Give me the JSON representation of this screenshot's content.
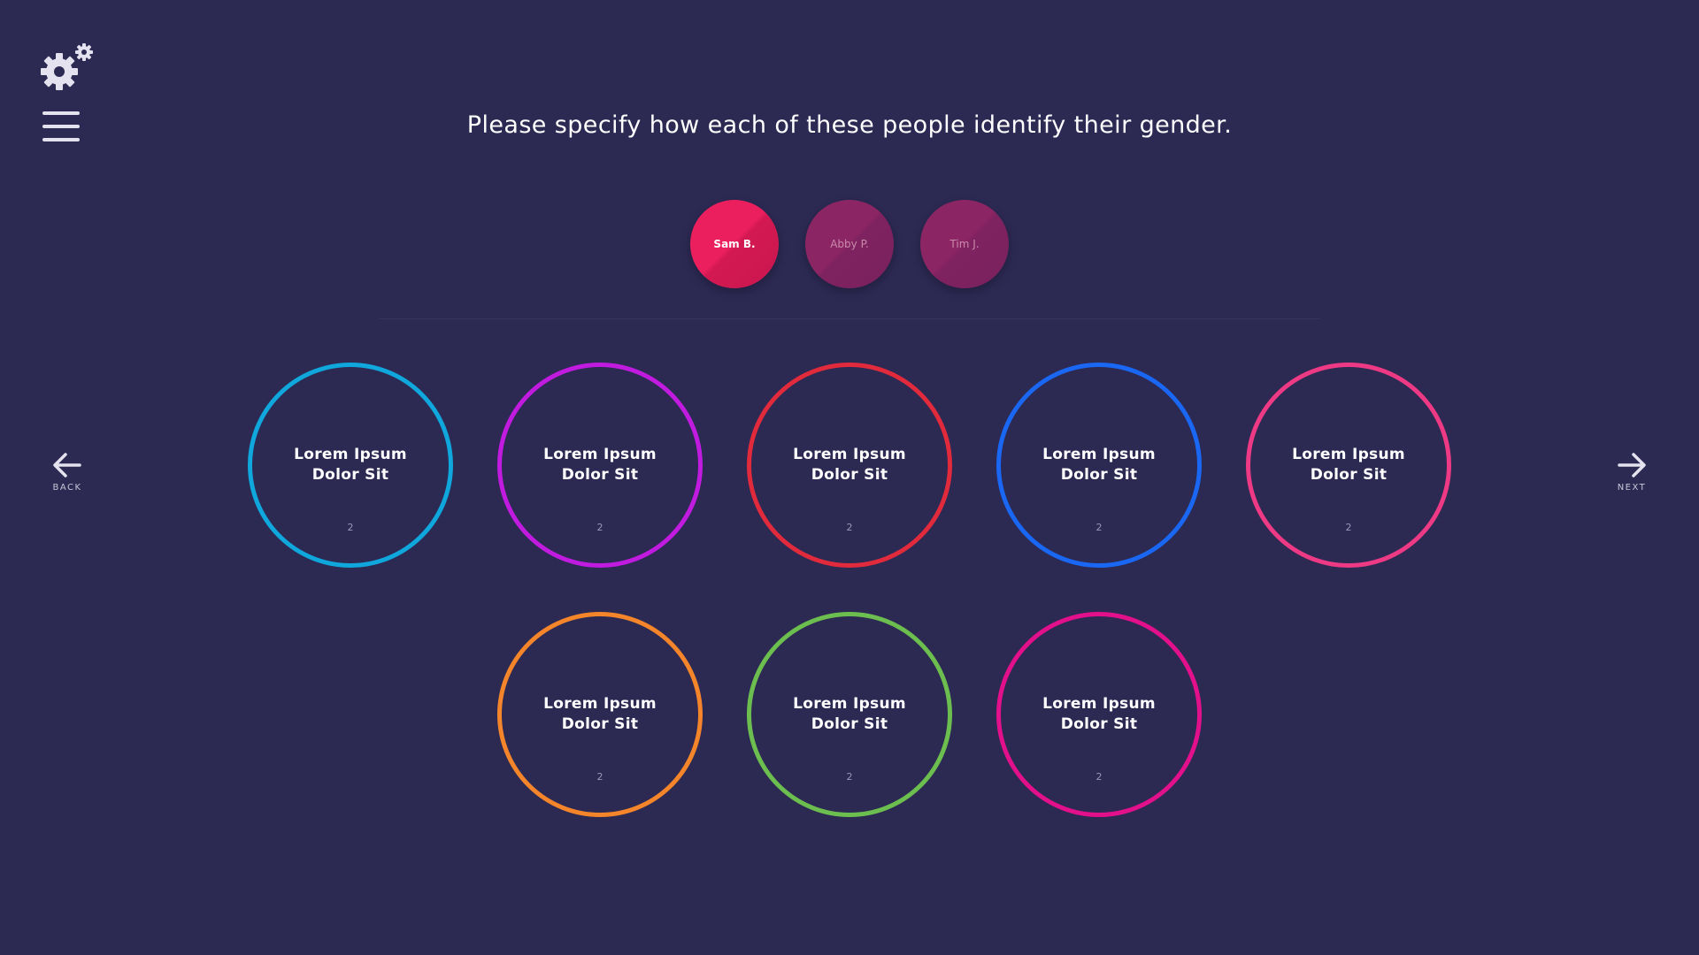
{
  "header": {
    "settings_icon": "gears-icon",
    "menu_icon": "hamburger-icon",
    "prompt": "Please specify how each of these people identify their gender."
  },
  "people": [
    {
      "name": "Sam B.",
      "active": true
    },
    {
      "name": "Abby P.",
      "active": false
    },
    {
      "name": "Tim J.",
      "active": false
    }
  ],
  "options": [
    {
      "line1": "Lorem Ipsum",
      "line2": "Dolor Sit",
      "count": "2",
      "color": "#0fa7dc"
    },
    {
      "line1": "Lorem Ipsum",
      "line2": "Dolor Sit",
      "count": "2",
      "color": "#c11be0"
    },
    {
      "line1": "Lorem Ipsum",
      "line2": "Dolor Sit",
      "count": "2",
      "color": "#e12a3c"
    },
    {
      "line1": "Lorem Ipsum",
      "line2": "Dolor Sit",
      "count": "2",
      "color": "#1967f2"
    },
    {
      "line1": "Lorem Ipsum",
      "line2": "Dolor Sit",
      "count": "2",
      "color": "#ee3a84"
    },
    {
      "line1": "Lorem Ipsum",
      "line2": "Dolor Sit",
      "count": "2",
      "color": "#f4852a"
    },
    {
      "line1": "Lorem Ipsum",
      "line2": "Dolor Sit",
      "count": "2",
      "color": "#6cbf4f"
    },
    {
      "line1": "Lorem Ipsum",
      "line2": "Dolor Sit",
      "count": "2",
      "color": "#e2108a"
    }
  ],
  "nav": {
    "back_label": "BACK",
    "next_label": "NEXT",
    "back_icon": "arrow-left-icon",
    "next_icon": "arrow-right-icon"
  },
  "colors": {
    "background": "#2c2953",
    "active_person": "#ec1f5e",
    "inactive_person": "#8c2563"
  }
}
